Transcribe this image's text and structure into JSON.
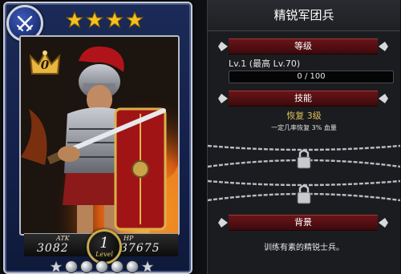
{
  "card": {
    "class_icon": "crossed-swords-icon",
    "star_count": 4,
    "rank_value": "0",
    "stats": {
      "atk_label": "ATK",
      "atk_value": "3082",
      "hp_label": "HP",
      "hp_value": "37675"
    },
    "level": {
      "value": "1",
      "word": "Level"
    },
    "evolution_orbs": 5,
    "colors": {
      "frame": "#1b2a57",
      "star": "#f3c020",
      "crown": "#e9b640"
    }
  },
  "panel": {
    "title": "精锐军团兵",
    "level_section": {
      "header": "等级",
      "level_text": "Lv.1 (最高 Lv.70)",
      "exp_text": "0 / 100",
      "exp_progress": 0.0
    },
    "skill_section": {
      "header": "技能",
      "skill_name": "恢复 3级",
      "skill_desc": "一定几率恢复 3% 血量",
      "locked_icon": "padlock-icon"
    },
    "bio_section": {
      "header": "背景",
      "text": "训练有素的精锐士兵。"
    },
    "colors": {
      "section_bar": "#6a1418",
      "skill_name": "#e2c15a",
      "exp_fill": "#6aa0ff"
    }
  }
}
